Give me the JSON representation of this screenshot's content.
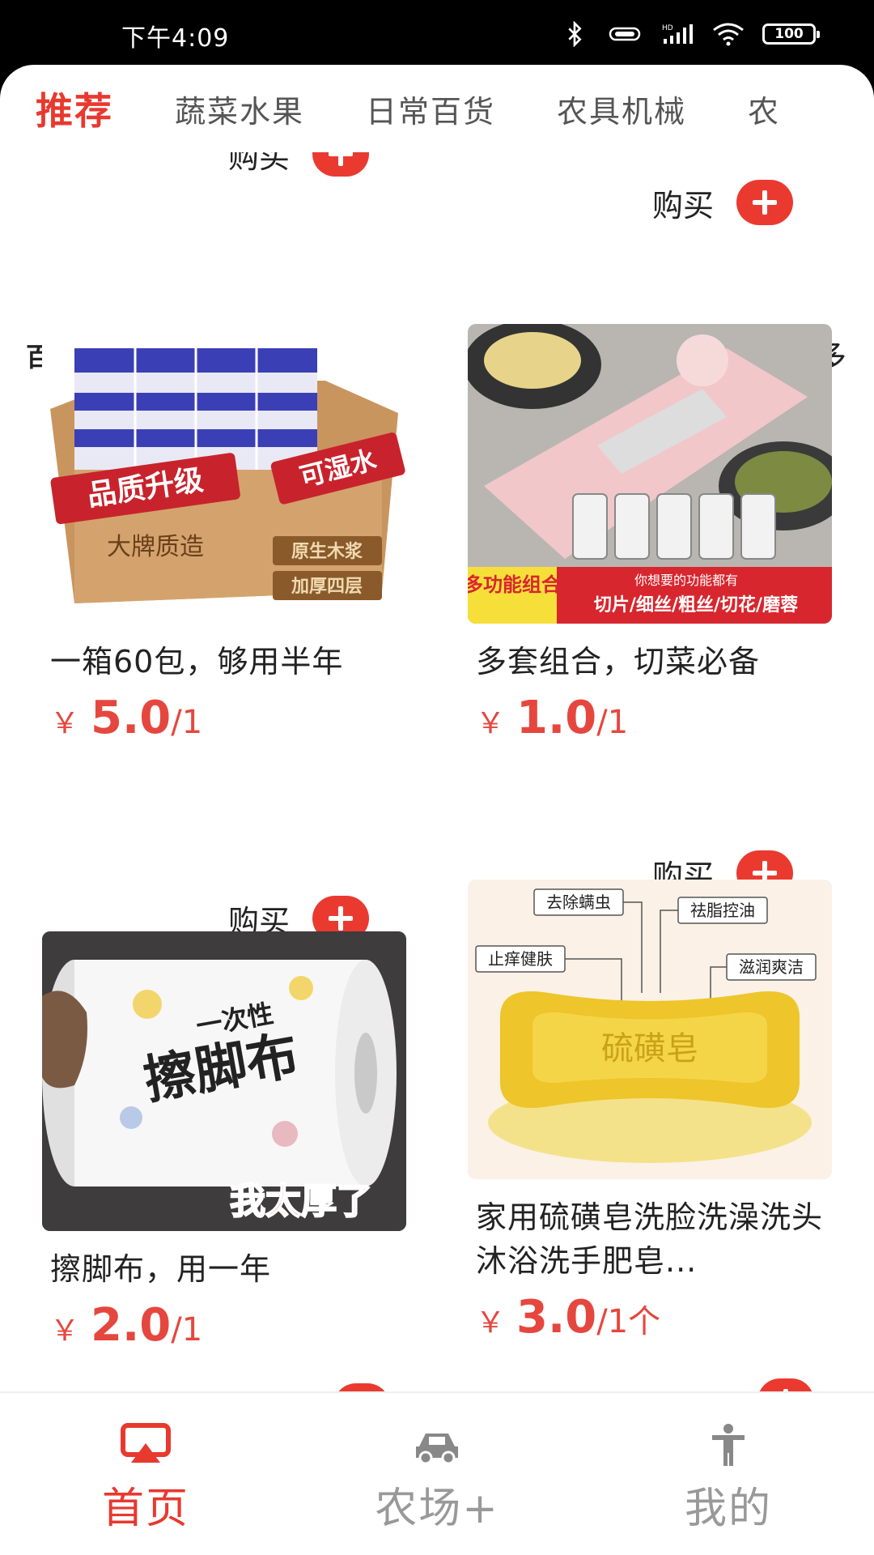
{
  "status_bar": {
    "time": "下午4:09",
    "battery": "100",
    "network": "HD"
  },
  "tabs": [
    {
      "label": "推荐",
      "active": true
    },
    {
      "label": "蔬菜水果",
      "active": false
    },
    {
      "label": "日常百货",
      "active": false
    },
    {
      "label": "农具机械",
      "active": false
    },
    {
      "label": "农",
      "active": false
    }
  ],
  "buy_label": "购买",
  "section": {
    "title": "百货",
    "more": "更多"
  },
  "products": [
    {
      "name": "一箱60包，够用半年",
      "currency": "￥",
      "price": "5.0",
      "unit": "/1",
      "image_texts": {
        "a": "品质升级",
        "b": "可湿水",
        "c": "大牌质造",
        "d": "原生木浆",
        "e": "加厚四层"
      }
    },
    {
      "name": "多套组合，切菜必备",
      "currency": "￥",
      "price": "1.0",
      "unit": "/1",
      "image_texts": {
        "a": "多功能组合",
        "b": "你想要的功能都有",
        "c": "切片/细丝/粗丝/切花/磨蓉"
      }
    },
    {
      "name": "擦脚布，用一年",
      "currency": "￥",
      "price": "2.0",
      "unit": "/1",
      "image_texts": {
        "a": "一次性",
        "b": "擦脚布",
        "c": "我太厚了"
      }
    },
    {
      "name": "家用硫磺皂洗脸洗澡洗头沐浴洗手肥皂...",
      "currency": "￥",
      "price": "3.0",
      "unit": "/1个",
      "image_texts": {
        "a": "去除螨虫",
        "b": "祛脂控油",
        "c": "止痒健肤",
        "d": "滋润爽洁",
        "e": "硫磺皂"
      }
    }
  ],
  "bottom_nav": [
    {
      "label": "首页",
      "icon": "home-airplay-icon",
      "active": true
    },
    {
      "label": "农场+",
      "icon": "car-icon",
      "active": false
    },
    {
      "label": "我的",
      "icon": "person-icon",
      "active": false
    }
  ],
  "colors": {
    "accent": "#e8392f",
    "price": "#e5473f",
    "inactive": "#999999"
  }
}
